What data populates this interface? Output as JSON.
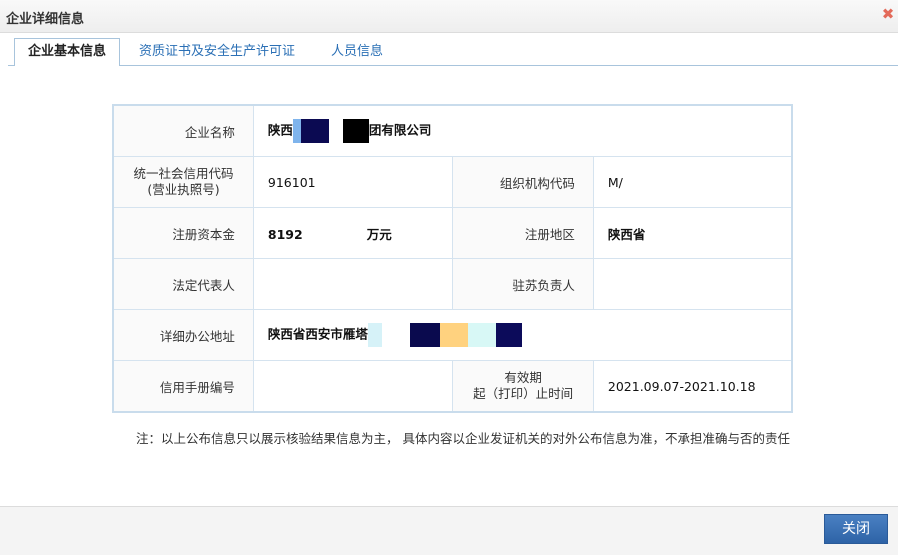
{
  "window": {
    "title": "企业详细信息",
    "close_glyph": "✖"
  },
  "tabs": [
    {
      "label": "企业基本信息"
    },
    {
      "label": "资质证书及安全生产许可证"
    },
    {
      "label": "人员信息"
    }
  ],
  "info": {
    "company_name_label": "企业名称",
    "company_name_prefix": "陕西",
    "company_name_suffix": "团有限公司",
    "credit_code_label_line1": "统一社会信用代码",
    "credit_code_label_line2": "(营业执照号)",
    "credit_code_value": "916101",
    "org_code_label": "组织机构代码",
    "org_code_value": "M/",
    "registered_capital_label": "注册资本金",
    "registered_capital_value": "8192",
    "registered_capital_unit": "万元",
    "registered_region_label": "注册地区",
    "registered_region_value": "陕西省",
    "legal_rep_label": "法定代表人",
    "legal_rep_value": "",
    "jiangsu_manager_label": "驻苏负责人",
    "jiangsu_manager_value": "",
    "office_address_label": "详细办公地址",
    "office_address_value": "陕西省西安市雁塔",
    "credit_manual_label": "信用手册编号",
    "credit_manual_value": "",
    "validity_label_line1": "有效期",
    "validity_label_line2": "起（打印）止时间",
    "validity_value": "2021.09.07-2021.10.18"
  },
  "note": "注：以上公布信息只以展示核验结果信息为主， 具体内容以企业发证机关的对外公布信息为准，不承担准确与否的责任",
  "footer": {
    "close_label": "关闭"
  },
  "colors": {
    "accent": "#2e63a7",
    "tab_link": "#2a6fb5",
    "close_x": "#e36a5a"
  }
}
